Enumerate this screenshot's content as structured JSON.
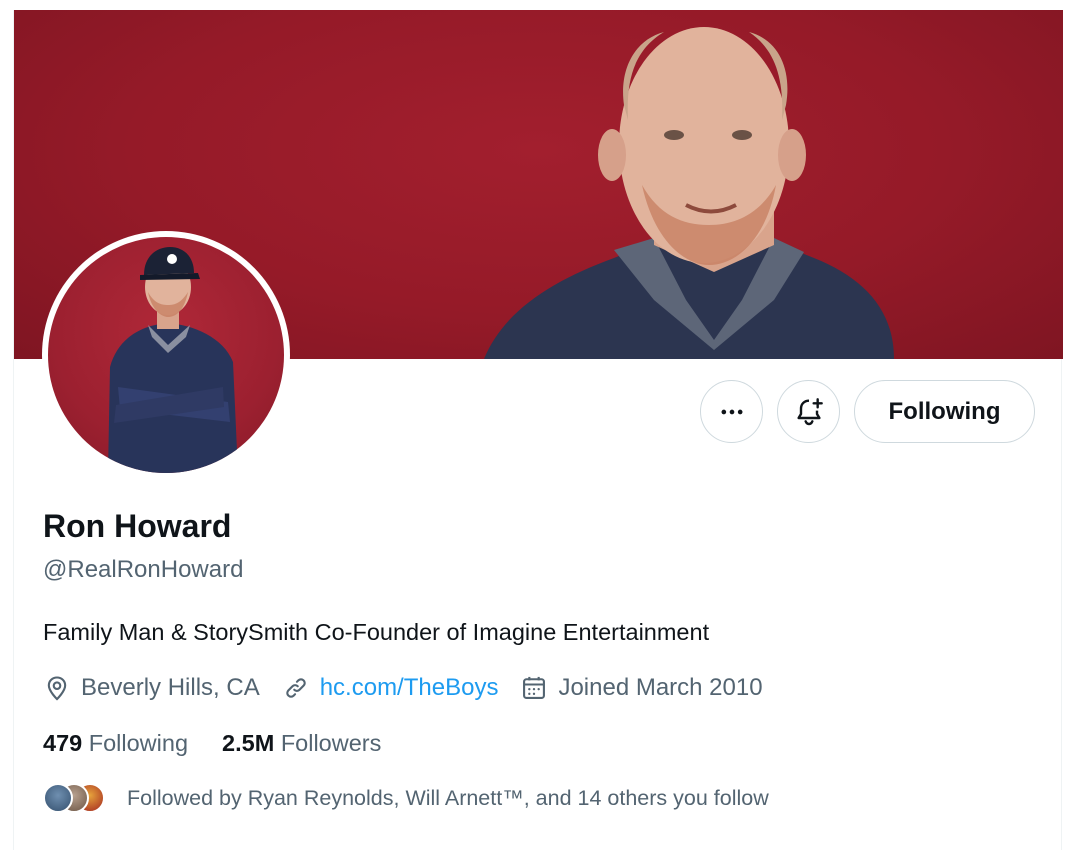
{
  "profile": {
    "display_name": "Ron Howard",
    "handle": "@RealRonHoward",
    "bio": "Family Man & StorySmith Co-Founder of Imagine Entertainment",
    "location": "Beverly Hills, CA",
    "website": "hc.com/TheBoys",
    "joined": "Joined March 2010",
    "following_count": "479",
    "following_label": "Following",
    "followers_count": "2.5M",
    "followers_label": "Followers",
    "followed_by": "Followed by Ryan Reynolds, Will Arnett™, and 14 others you follow"
  },
  "actions": {
    "more_icon": "more-horizontal-icon",
    "notify_icon": "bell-plus-icon",
    "following_button": "Following"
  },
  "icons": {
    "location": "location-pin-icon",
    "link": "link-icon",
    "calendar": "calendar-icon"
  },
  "colors": {
    "banner": "#951a28",
    "link": "#1d9bf0",
    "secondary_text": "#536471",
    "primary_text": "#0f1419"
  }
}
